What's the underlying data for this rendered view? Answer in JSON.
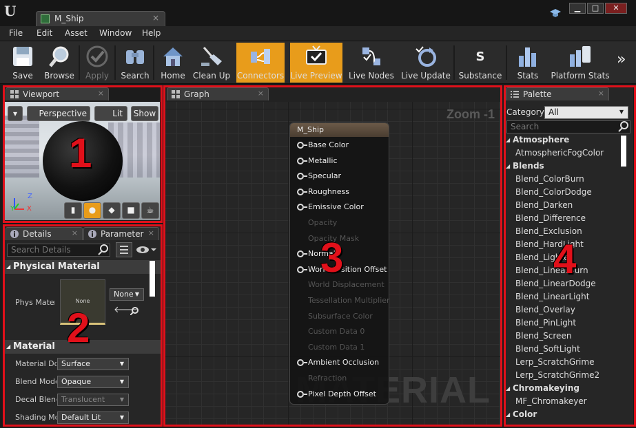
{
  "window": {
    "tab_title": "M_Ship",
    "tab_close": "×",
    "controls": {
      "minimize": "▁",
      "maximize": "□",
      "close": "✕"
    },
    "logo": "U"
  },
  "menu": [
    "File",
    "Edit",
    "Asset",
    "Window",
    "Help"
  ],
  "toolbar": [
    {
      "label": "Save",
      "icon": "save-icon"
    },
    {
      "label": "Browse",
      "icon": "magnifier-icon"
    },
    {
      "label": "Apply",
      "icon": "checkmark-icon",
      "disabled": true
    },
    {
      "label": "Search",
      "icon": "binoculars-icon"
    },
    {
      "label": "Home",
      "icon": "house-icon"
    },
    {
      "label": "Clean Up",
      "icon": "broom-icon"
    },
    {
      "label": "Connectors",
      "icon": "connectors-icon",
      "active": true
    },
    {
      "label": "Live Preview",
      "icon": "tv-icon",
      "active": true
    },
    {
      "label": "Live Nodes",
      "icon": "nodes-icon"
    },
    {
      "label": "Live Update",
      "icon": "refresh-icon"
    },
    {
      "label": "Substance",
      "icon": "substance-icon"
    },
    {
      "label": "Stats",
      "icon": "bar-chart-icon"
    },
    {
      "label": "Platform Stats",
      "icon": "platform-stats-icon"
    }
  ],
  "toolbar_more": "»",
  "viewport": {
    "tab": "Viewport",
    "close": "×",
    "perspective": "Perspective",
    "lit": "Lit",
    "show": "Show",
    "number": "1",
    "axes": {
      "x": "X",
      "y": "Y",
      "z": "Z"
    }
  },
  "details": {
    "tab1": "Details",
    "tab2": "Parameter",
    "close": "×",
    "search_placeholder": "Search Details",
    "section1": "Physical Material",
    "phys_label": "Phys Mater",
    "thumb_text": "None",
    "phys_value": "None",
    "section2": "Material",
    "rows": [
      {
        "label": "Material Do",
        "value": "Surface"
      },
      {
        "label": "Blend Mode",
        "value": "Opaque"
      },
      {
        "label": "Decal Blenc",
        "value": "Translucent",
        "disabled": true
      },
      {
        "label": "Shading Mo",
        "value": "Default Lit"
      }
    ],
    "number": "2"
  },
  "graph": {
    "tab": "Graph",
    "close": "×",
    "zoom": "Zoom -1",
    "node_title": "M_Ship",
    "watermark": "MATERIAL",
    "pins": [
      {
        "label": "Base Color",
        "enabled": true
      },
      {
        "label": "Metallic",
        "enabled": true
      },
      {
        "label": "Specular",
        "enabled": true
      },
      {
        "label": "Roughness",
        "enabled": true
      },
      {
        "label": "Emissive Color",
        "enabled": true
      },
      {
        "label": "Opacity",
        "enabled": false
      },
      {
        "label": "Opacity Mask",
        "enabled": false
      },
      {
        "label": "Normal",
        "enabled": true
      },
      {
        "label": "World Position Offset",
        "enabled": true
      },
      {
        "label": "World Displacement",
        "enabled": false
      },
      {
        "label": "Tessellation Multiplier",
        "enabled": false
      },
      {
        "label": "Subsurface Color",
        "enabled": false
      },
      {
        "label": "Custom Data 0",
        "enabled": false
      },
      {
        "label": "Custom Data 1",
        "enabled": false
      },
      {
        "label": "Ambient Occlusion",
        "enabled": true
      },
      {
        "label": "Refraction",
        "enabled": false
      },
      {
        "label": "Pixel Depth Offset",
        "enabled": true
      }
    ],
    "number": "3"
  },
  "palette": {
    "tab": "Palette",
    "close": "×",
    "category_label": "Category:",
    "category_value": "All",
    "search_placeholder": "Search",
    "items": [
      {
        "text": "Atmosphere",
        "cat": true
      },
      {
        "text": "AtmosphericFogColor"
      },
      {
        "text": "Blends",
        "cat": true
      },
      {
        "text": "Blend_ColorBurn"
      },
      {
        "text": "Blend_ColorDodge"
      },
      {
        "text": "Blend_Darken"
      },
      {
        "text": "Blend_Difference"
      },
      {
        "text": "Blend_Exclusion"
      },
      {
        "text": "Blend_HardLight"
      },
      {
        "text": "Blend_Lighten"
      },
      {
        "text": "Blend_LinearBurn"
      },
      {
        "text": "Blend_LinearDodge"
      },
      {
        "text": "Blend_LinearLight"
      },
      {
        "text": "Blend_Overlay"
      },
      {
        "text": "Blend_PinLight"
      },
      {
        "text": "Blend_Screen"
      },
      {
        "text": "Blend_SoftLight"
      },
      {
        "text": "Lerp_ScratchGrime"
      },
      {
        "text": "Lerp_ScratchGrime2"
      },
      {
        "text": "Chromakeying",
        "cat": true
      },
      {
        "text": "MF_Chromakeyer"
      },
      {
        "text": "Color",
        "cat": true
      }
    ],
    "number": "4"
  },
  "colors": {
    "highlight": "#e1101a",
    "active": "#e89c1b"
  }
}
